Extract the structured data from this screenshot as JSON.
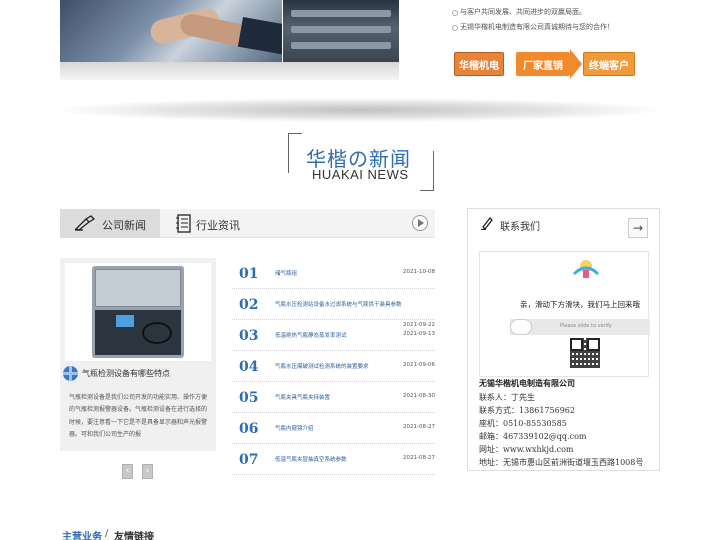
{
  "banner": {
    "slogans": [
      "与客户共同发展、共同进步的双赢局面。",
      "无锡华楷机电制造有限公司真诚期待与您的合作！"
    ],
    "steps": [
      "华楷机电",
      "厂家直销",
      "终端客户"
    ]
  },
  "section": {
    "title_cn": "华楷の新闻",
    "title_en": "HUAKAI NEWS"
  },
  "news_tabs": [
    {
      "label": "公司新闻",
      "active": true,
      "icon": "writing-hand-icon"
    },
    {
      "label": "行业资讯",
      "active": false,
      "icon": "notebook-icon"
    }
  ],
  "featured": {
    "title": "气瓶检测设备有哪些特点",
    "description": "气瓶检测设备是我们公司开发的功能实用、操作方便的气瓶检测报警器设备。气瓶检测设备在进行选择的时候，要注意看一下它是不是具备显示器和声光报警器。可和我们公司生产的报"
  },
  "news": [
    {
      "num": "01",
      "title": "储气瓶组",
      "date": "2021-10-08"
    },
    {
      "num": "02",
      "title": "气瓶水压检测站设备水过滤系统与气瓶烘干装具参数",
      "date": "2021-09-22"
    },
    {
      "num": "03",
      "title": "低温绝热气瓶静态蒸发率测试",
      "date": "2021-09-13"
    },
    {
      "num": "04",
      "title": "气瓶水压爆破测试检测系统的装置要求",
      "date": "2021-09-06"
    },
    {
      "num": "05",
      "title": "气瓶夹具气瓶夹持装置",
      "date": "2021-08-30"
    },
    {
      "num": "06",
      "title": "气瓶内窥镜介绍",
      "date": "2021-08-27"
    },
    {
      "num": "07",
      "title": "低温气瓶夹层抽真空系统参数",
      "date": "2021-08-27"
    }
  ],
  "contact": {
    "title": "联系我们",
    "arrow": "→",
    "captcha_text": "亲，滑动下方滑块，我们马上回来哦",
    "slider_text": "Please slide to verify",
    "company": "无锡华楷机电制造有限公司",
    "lines": [
      "联系人：丁先生",
      "联系方式：13861756962",
      "座机：0510-85530585",
      "邮箱：467339102@qq.com",
      "网址：www.wxhkjd.com",
      "地址：无锡市惠山区前洲街道堰玉西路1008号"
    ]
  },
  "footer": {
    "main_business": "主营业务",
    "separator": "/",
    "friend_links": "友情链接"
  },
  "colors": {
    "accent_blue": "#2d6bb2",
    "orange": "#f08a2c"
  }
}
